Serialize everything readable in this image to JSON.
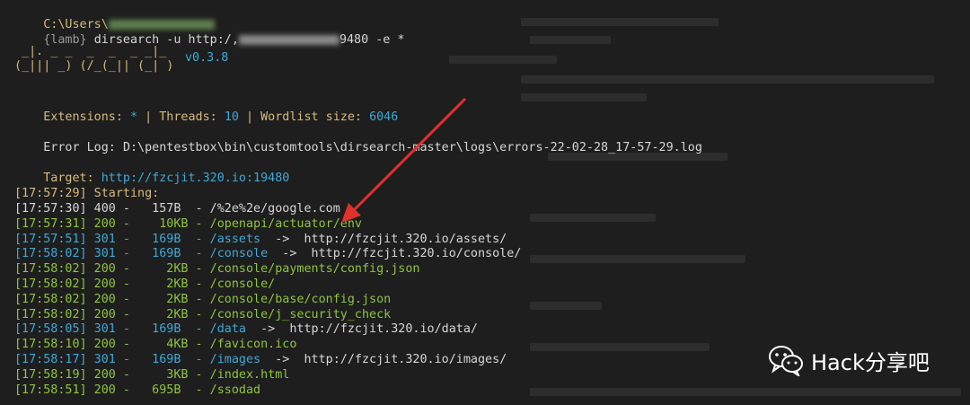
{
  "prompt": {
    "path": "C:\\Users\\",
    "env": "{lamb}",
    "command_prefix": "dirsearch -u http:/,",
    "command_suffix": "9480 -e *"
  },
  "banner": {
    "ascii_line1": " _|. _ _  _  _  _ _|_",
    "ascii_line2": "(_||| _) (/_(_|| (_| )",
    "version": "v0.3.8"
  },
  "config": {
    "ext_label": "Extensions:",
    "ext_value": "*",
    "sep": "|",
    "threads_label": "Threads:",
    "threads_value": "10",
    "wordlist_label": "Wordlist size:",
    "wordlist_value": "6046"
  },
  "error_log": {
    "label": "Error Log:",
    "path": "D:\\pentestbox\\bin\\customtools\\dirsearch-master\\logs\\errors-22-02-28_17-57-29.log"
  },
  "target": {
    "label": "Target:",
    "url": "http://fzcjit.320.io:19480"
  },
  "starting": "[17:57:29] Starting:",
  "results": [
    {
      "text": "[17:57:30] 400 -   157B  - /%2e%2e/google.com",
      "color": "#d6d6d6"
    },
    {
      "text": "[17:57:31] 200 -    10KB - /openapi/actuator/env",
      "color": "#8fc43f"
    },
    {
      "text": "[17:57:51] 301 -   169B  - /assets",
      "redirect": "  ->  http://fzcjit.320.io/assets/",
      "color": "#3fa9d6"
    },
    {
      "text": "[17:58:02] 301 -   169B  - /console",
      "redirect": "  ->  http://fzcjit.320.io/console/",
      "color": "#3fa9d6"
    },
    {
      "text": "[17:58:02] 200 -     2KB - /console/payments/config.json",
      "color": "#8fc43f"
    },
    {
      "text": "[17:58:02] 200 -     2KB - /console/",
      "color": "#8fc43f"
    },
    {
      "text": "[17:58:02] 200 -     2KB - /console/base/config.json",
      "color": "#8fc43f"
    },
    {
      "text": "[17:58:02] 200 -     2KB - /console/j_security_check",
      "color": "#8fc43f"
    },
    {
      "text": "[17:58:05] 301 -   169B  - /data",
      "redirect": "  ->  http://fzcjit.320.io/data/",
      "color": "#3fa9d6"
    },
    {
      "text": "[17:58:10] 200 -     4KB - /favicon.ico",
      "color": "#8fc43f"
    },
    {
      "text": "[17:58:17] 301 -   169B  - /images",
      "redirect": "  ->  http://fzcjit.320.io/images/",
      "color": "#3fa9d6"
    },
    {
      "text": "[17:58:19] 200 -     3KB - /index.html",
      "color": "#8fc43f"
    },
    {
      "text": "[17:58:51] 200 -   695B  - /ssodad",
      "color": "#8fc43f"
    }
  ],
  "watermark": {
    "text": "Hack分享吧",
    "icon": "wechat-icon"
  },
  "colors": {
    "background": "#1e1e1e",
    "arrow": "#e0312b"
  }
}
